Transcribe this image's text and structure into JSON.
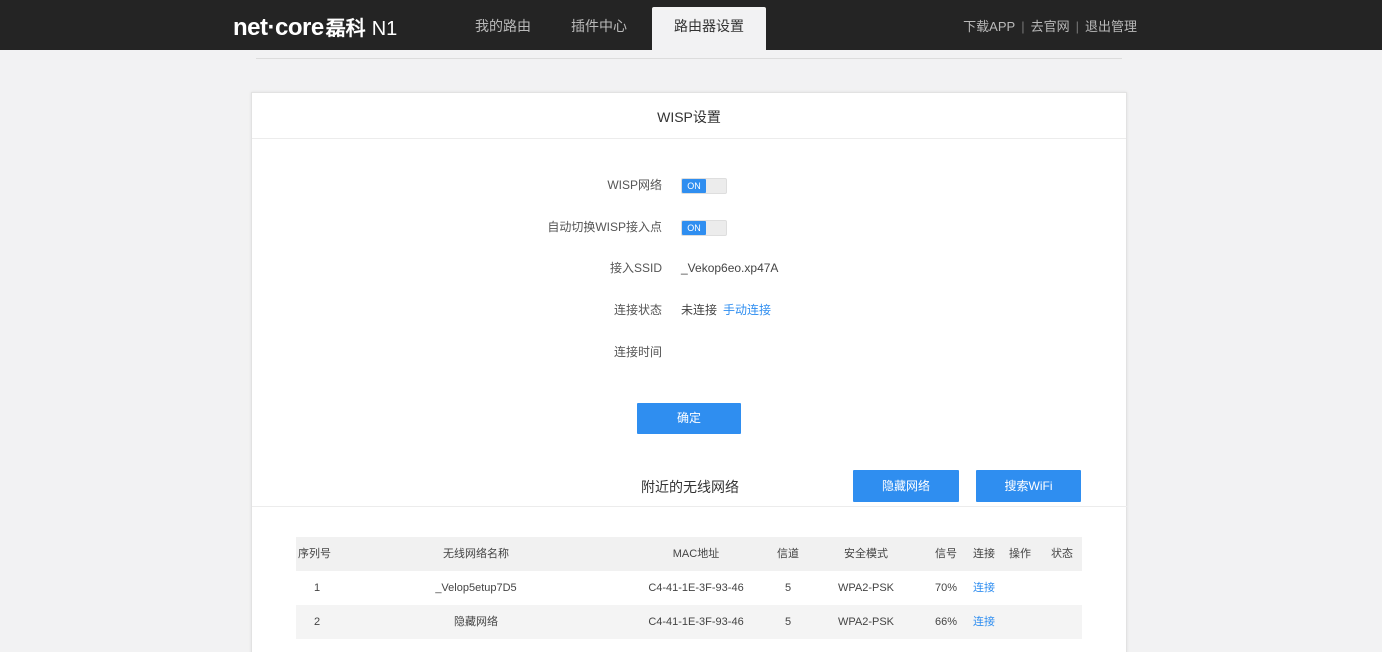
{
  "header": {
    "logo_brand": "net·core",
    "logo_cn": "磊科",
    "logo_model": "N1",
    "tabs": [
      {
        "label": "我的路由"
      },
      {
        "label": "插件中心"
      },
      {
        "label": "路由器设置"
      }
    ],
    "links": [
      {
        "label": "下载APP"
      },
      {
        "label": "去官网"
      },
      {
        "label": "退出管理"
      }
    ]
  },
  "card": {
    "title": "WISP设置",
    "rows": {
      "wisp_network": {
        "label": "WISP网络",
        "toggle_text": "ON"
      },
      "auto_switch": {
        "label": "自动切换WISP接入点",
        "toggle_text": "ON"
      },
      "ssid": {
        "label": "接入SSID",
        "value": "_Vekop6eo.xp47A"
      },
      "status": {
        "label": "连接状态",
        "value": "未连接",
        "link": "手动连接"
      },
      "duration": {
        "label": "连接时间",
        "value": ""
      }
    },
    "confirm_button": "确定",
    "nearby_title": "附近的无线网络",
    "hidden_network_button": "隐藏网络",
    "search_wifi_button": "搜索WiFi"
  },
  "table": {
    "headers": [
      "序列号",
      "无线网络名称",
      "MAC地址",
      "信道",
      "安全模式",
      "信号",
      "连接",
      "操作",
      "状态"
    ],
    "rows": [
      {
        "index": "1",
        "name": "_Velop5etup7D5",
        "mac": "C4-41-1E-3F-93-46",
        "channel": "5",
        "security": "WPA2-PSK",
        "signal": "70%",
        "connect": "连接"
      },
      {
        "index": "2",
        "name": "隐藏网络",
        "mac": "C4-41-1E-3F-93-46",
        "channel": "5",
        "security": "WPA2-PSK",
        "signal": "66%",
        "connect": "连接"
      }
    ]
  },
  "colors": {
    "accent": "#2f8ef0",
    "topbar": "#242424"
  }
}
